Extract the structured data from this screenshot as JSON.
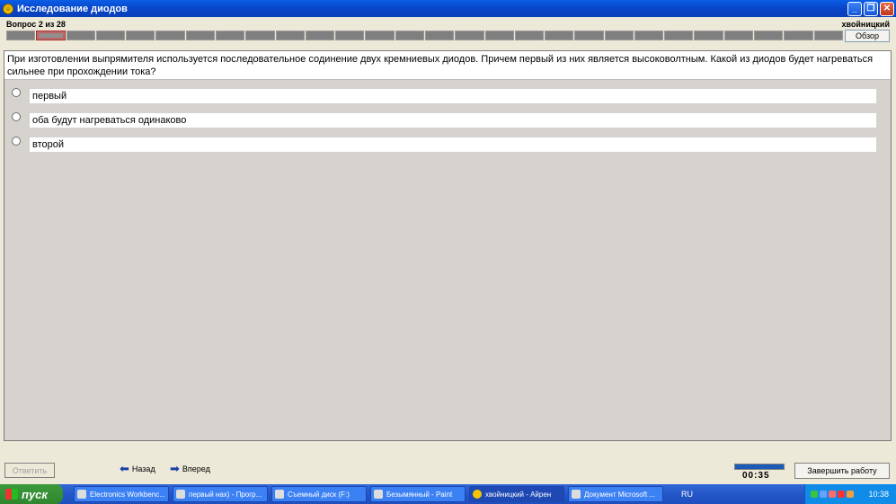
{
  "window": {
    "title": "Исследование диодов"
  },
  "header": {
    "question_counter": "Вопрос 2 из 28",
    "username": "хвойницкий",
    "browse_label": "Обзор",
    "total_questions": 28,
    "current_question": 2
  },
  "question": {
    "text": "При изготовлении выпрямителя используется последовательное содинение двух кремниевых диодов. Причем первый из них является высоковолтным. Какой из диодов будет нагреваться сильнее при прохождении тока?",
    "options": [
      {
        "label": "первый"
      },
      {
        "label": "оба будут нагреваться одинаково"
      },
      {
        "label": "второй"
      }
    ]
  },
  "bottom": {
    "answer_label": "Ответить",
    "back_label": "Назад",
    "forward_label": "Вперед",
    "timer": "00:35",
    "finish_label": "Завершить работу"
  },
  "taskbar": {
    "start_label": "пуск",
    "tasks": [
      {
        "label": "Electronics Workbenc..."
      },
      {
        "label": "первый нах) - Прогр..."
      },
      {
        "label": "Съемный диск (F:)"
      },
      {
        "label": "Безымянный - Paint"
      },
      {
        "label": "хвойницкий - Айрен"
      },
      {
        "label": "Документ Microsoft ..."
      }
    ],
    "language": "RU",
    "clock": "10:38"
  },
  "colors": {
    "titlebar": "#0845c8",
    "taskbar": "#2456c7",
    "current_marker": "#c21818"
  }
}
